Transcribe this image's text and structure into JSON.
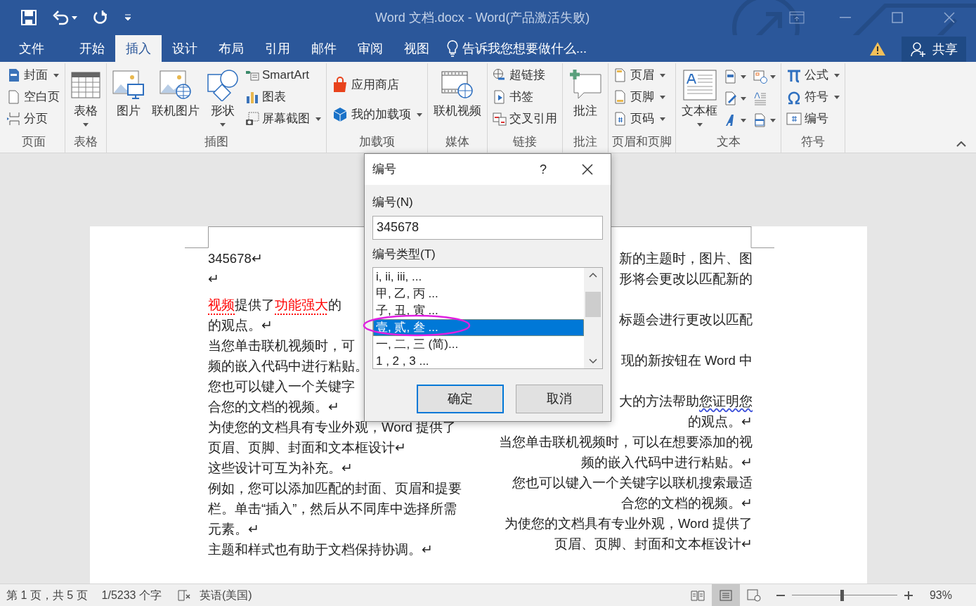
{
  "window": {
    "title": "Word 文档.docx - Word(产品激活失败)"
  },
  "menu_tabs": [
    {
      "label": "文件",
      "selected": false
    },
    {
      "label": "开始",
      "selected": false
    },
    {
      "label": "插入",
      "selected": true
    },
    {
      "label": "设计",
      "selected": false
    },
    {
      "label": "布局",
      "selected": false
    },
    {
      "label": "引用",
      "selected": false
    },
    {
      "label": "邮件",
      "selected": false
    },
    {
      "label": "审阅",
      "selected": false
    },
    {
      "label": "视图",
      "selected": false
    }
  ],
  "tell_me": {
    "placeholder": "告诉我您想要做什么..."
  },
  "share": {
    "label": "共享"
  },
  "ribbon_groups": [
    {
      "label": "页面",
      "items": [
        {
          "kind": "small",
          "label": "封面",
          "dropdown": true
        },
        {
          "kind": "small",
          "label": "空白页",
          "dropdown": false
        },
        {
          "kind": "small",
          "label": "分页",
          "dropdown": false
        }
      ]
    },
    {
      "label": "表格",
      "items": [
        {
          "kind": "large",
          "label": "表格",
          "dropdown": true
        }
      ]
    },
    {
      "label": "插图",
      "items": [
        {
          "kind": "large",
          "label": "图片",
          "dropdown": false
        },
        {
          "kind": "large",
          "label": "联机图片",
          "dropdown": false
        },
        {
          "kind": "large",
          "label": "形状",
          "dropdown": true
        },
        {
          "kind": "small",
          "label": "SmartArt",
          "dropdown": false
        },
        {
          "kind": "small",
          "label": "图表",
          "dropdown": false
        },
        {
          "kind": "small",
          "label": "屏幕截图",
          "dropdown": true
        }
      ]
    },
    {
      "label": "加载项",
      "items": [
        {
          "kind": "small",
          "label": "应用商店",
          "dropdown": false
        },
        {
          "kind": "small",
          "label": "我的加载项",
          "dropdown": true
        }
      ]
    },
    {
      "label": "媒体",
      "items": [
        {
          "kind": "large",
          "label": "联机视频",
          "dropdown": false
        }
      ]
    },
    {
      "label": "链接",
      "items": [
        {
          "kind": "small",
          "label": "超链接",
          "dropdown": false
        },
        {
          "kind": "small",
          "label": "书签",
          "dropdown": false
        },
        {
          "kind": "small",
          "label": "交叉引用",
          "dropdown": false
        }
      ]
    },
    {
      "label": "批注",
      "items": [
        {
          "kind": "large",
          "label": "批注",
          "dropdown": false
        }
      ]
    },
    {
      "label": "页眉和页脚",
      "items": [
        {
          "kind": "small",
          "label": "页眉",
          "dropdown": true
        },
        {
          "kind": "small",
          "label": "页脚",
          "dropdown": true
        },
        {
          "kind": "small",
          "label": "页码",
          "dropdown": true
        }
      ]
    },
    {
      "label": "文本",
      "items": [
        {
          "kind": "large",
          "label": "文本框",
          "dropdown": true
        },
        {
          "kind": "icon",
          "dropdown": true
        },
        {
          "kind": "icon",
          "dropdown": true
        },
        {
          "kind": "icon",
          "dropdown": true
        },
        {
          "kind": "icon",
          "dropdown": true
        },
        {
          "kind": "icon",
          "dropdown": false
        },
        {
          "kind": "icon",
          "dropdown": true
        }
      ]
    },
    {
      "label": "符号",
      "items": [
        {
          "kind": "small",
          "label": "公式",
          "dropdown": true
        },
        {
          "kind": "small",
          "label": "符号",
          "dropdown": true
        },
        {
          "kind": "small",
          "label": "编号",
          "dropdown": false
        }
      ]
    }
  ],
  "document": {
    "left_column": [
      {
        "segments": [
          {
            "text": "345678↵",
            "emphasized": false
          }
        ]
      },
      {
        "segments": [
          {
            "text": "↵",
            "emphasized": false
          }
        ]
      },
      {
        "segments": [
          {
            "text": "视频",
            "emphasized": true
          },
          {
            "text": "提供了",
            "emphasized": false
          },
          {
            "text": "功能强大",
            "emphasized": true
          },
          {
            "text": "的",
            "emphasized": false
          }
        ]
      },
      {
        "segments": [
          {
            "text": "的观点。↵",
            "emphasized": false
          }
        ]
      },
      {
        "segments": [
          {
            "text": "当您单击联机视频时，可",
            "emphasized": false
          }
        ]
      },
      {
        "segments": [
          {
            "text": "频的嵌入代码中进行粘贴。",
            "emphasized": false
          }
        ]
      },
      {
        "segments": [
          {
            "text": "您也可以键入一个关键字",
            "emphasized": false
          }
        ]
      },
      {
        "segments": [
          {
            "text": "合您的文档的视频。↵",
            "emphasized": false
          }
        ]
      },
      {
        "segments": [
          {
            "text": "为使您的文档具有专业外观，Word 提供了",
            "emphasized": false
          }
        ]
      },
      {
        "segments": [
          {
            "text": "页眉、页脚、封面和文本框设计↵",
            "emphasized": false
          }
        ]
      },
      {
        "segments": [
          {
            "text": "这些设计可互为补充。↵",
            "emphasized": false
          }
        ]
      },
      {
        "segments": [
          {
            "text": "例如，您可以添加匹配的封面、页眉和提要",
            "emphasized": false
          }
        ]
      },
      {
        "segments": [
          {
            "text": "栏。单击“插入”，然后从不同库中选择所需",
            "emphasized": false
          }
        ]
      },
      {
        "segments": [
          {
            "text": "元素。↵",
            "emphasized": false
          }
        ]
      },
      {
        "segments": [
          {
            "text": "主题和样式也有助于文档保持协调。↵",
            "emphasized": false
          }
        ]
      }
    ],
    "right_column": [
      {
        "segments": [
          {
            "text": "新的主题时，图片、图",
            "flagged": false
          }
        ]
      },
      {
        "segments": [
          {
            "text": "形将会更改以匹配新的",
            "flagged": false
          }
        ]
      },
      {
        "segments": [
          {
            "text": "标题会进行更改以匹配",
            "flagged": false
          }
        ]
      },
      {
        "segments": [
          {
            "text": "现的新按钮在 Word 中",
            "flagged": false
          }
        ]
      },
      {
        "segments": [
          {
            "text": "大的方法帮助",
            "flagged": false
          },
          {
            "text": "您证明您",
            "flagged": true
          }
        ]
      },
      {
        "segments": [
          {
            "text": "的观点。↵",
            "flagged": false
          }
        ]
      },
      {
        "segments": [
          {
            "text": "当您单击联机视频时，可以在想要添加的视",
            "flagged": false
          }
        ]
      },
      {
        "segments": [
          {
            "text": "频的嵌入代码中进行粘贴。↵",
            "flagged": false
          }
        ]
      },
      {
        "segments": [
          {
            "text": "您也可以键入一个关键字以联机搜索最适",
            "flagged": false
          }
        ]
      },
      {
        "segments": [
          {
            "text": "合您的文档的视频。↵",
            "flagged": false
          }
        ]
      },
      {
        "segments": [
          {
            "text": "为使您的文档具有专业外观，Word 提供了",
            "flagged": false
          }
        ]
      },
      {
        "segments": [
          {
            "text": "页眉、页脚、封面和文本框设计↵",
            "flagged": false
          }
        ]
      }
    ]
  },
  "dialog": {
    "title": "编号",
    "help": "?",
    "number_label": "编号(N)",
    "number_value": "345678",
    "type_label": "编号类型(T)",
    "types": [
      {
        "label": "i, ii, iii, ...",
        "selected": false
      },
      {
        "label": "甲, 乙, 丙 ...",
        "selected": false
      },
      {
        "label": "子, 丑, 寅 ...",
        "selected": false
      },
      {
        "label": "壹, 贰, 叁 ...",
        "selected": true
      },
      {
        "label": "一, 二, 三 (简)...",
        "selected": false
      },
      {
        "label": "1 , 2 , 3  ...",
        "selected": false
      }
    ],
    "buttons": [
      {
        "label": "确定",
        "default": true
      },
      {
        "label": "取消",
        "default": false
      }
    ]
  },
  "status_bar": {
    "page": "第 1 页，共 5 页",
    "words": "1/5233 个字",
    "language": "英语(美国)",
    "views": [
      {
        "selected": false
      },
      {
        "selected": true
      },
      {
        "selected": false
      }
    ],
    "zoom": {
      "level": 0.46,
      "reading": "93%"
    }
  }
}
